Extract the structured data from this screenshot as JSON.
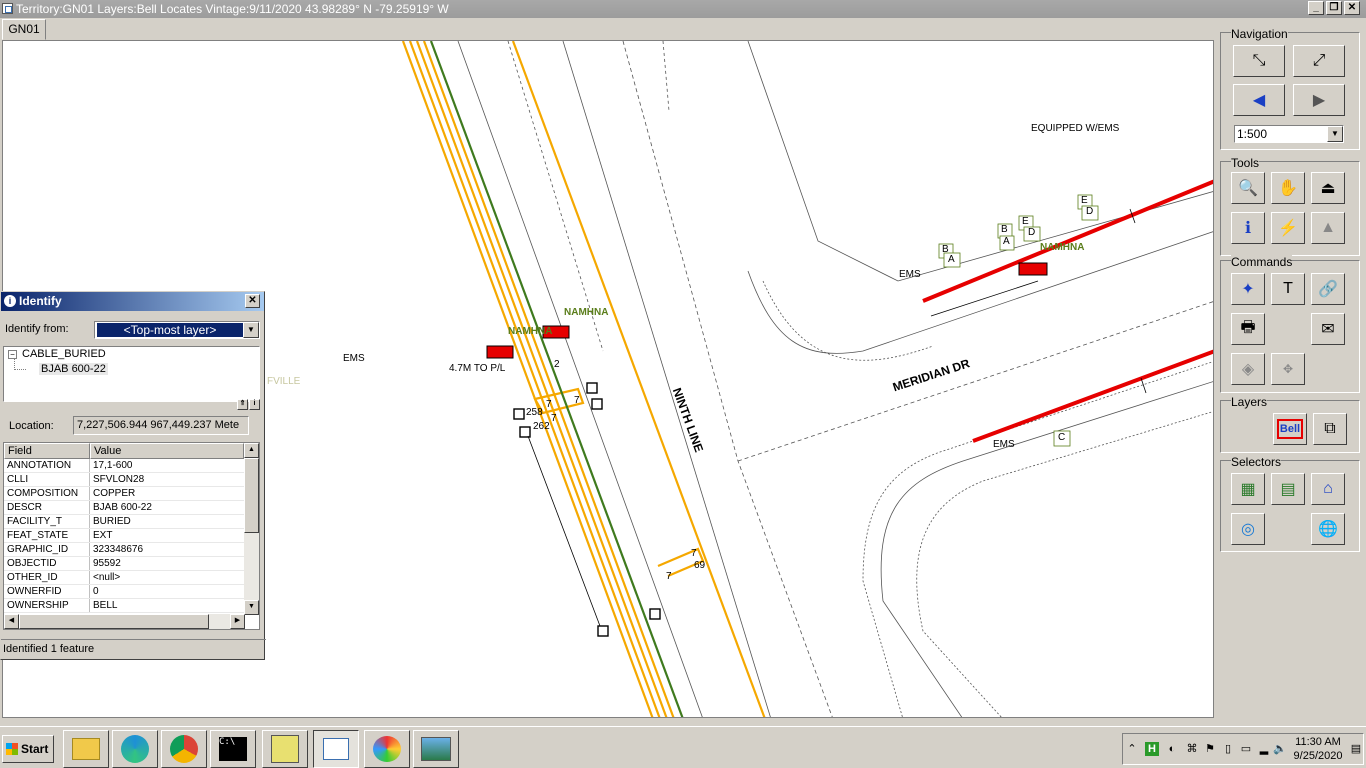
{
  "window": {
    "title": "Territory:GN01 Layers:Bell Locates Vintage:9/11/2020   43.98289° N   -79.25919° W",
    "controls": [
      "_",
      "❐",
      "✕"
    ]
  },
  "tabs": [
    {
      "label": "GN01"
    }
  ],
  "map": {
    "labels": {
      "equipped": "EQUIPPED W/EMS",
      "namhna1": "NAMHNA",
      "namhna2": "NAMHNA",
      "namhna3": "NAMHNA",
      "ems1": "EMS",
      "ems2": "EMS",
      "ems3": "EMS",
      "tolpl": "4.7M TO P/L",
      "fville": "FVILLE",
      "ninth": "NINTH LINE",
      "meridian": "MERIDIAN DR",
      "n2": "2",
      "n7a": "7",
      "n7b": "7",
      "n7c": "7",
      "n258": "258",
      "n262": "262",
      "n7d": "7",
      "n69": "69",
      "n7e": "7",
      "bA1": "B",
      "bA2": "A",
      "bA3": "B",
      "bA4": "A",
      "bE1": "E",
      "bD1": "D",
      "bE2": "E",
      "bD2": "D",
      "bC": "C"
    }
  },
  "navigation": {
    "title": "Navigation",
    "scale": "1:500",
    "buttons": [
      "zoom-in-extent",
      "zoom-full-extent",
      "back",
      "forward"
    ]
  },
  "tools": {
    "title": "Tools"
  },
  "commands": {
    "title": "Commands"
  },
  "layers": {
    "title": "Layers",
    "bell_label": "Bell"
  },
  "selectors": {
    "title": "Selectors"
  },
  "identify": {
    "title": "Identify",
    "from_label": "Identify from:",
    "from_value": "<Top-most layer>",
    "tree_root": "CABLE_BURIED",
    "tree_child": "BJAB 600-22",
    "location_label": "Location:",
    "location_value": "7,227,506.944  967,449.237 Mete",
    "col_field": "Field",
    "col_value": "Value",
    "rows": [
      {
        "field": "ANNOTATION",
        "value": "17,1-600"
      },
      {
        "field": "CLLI",
        "value": "SFVLON28"
      },
      {
        "field": "COMPOSITION",
        "value": "COPPER"
      },
      {
        "field": "DESCR",
        "value": "BJAB 600-22"
      },
      {
        "field": "FACILITY_T",
        "value": "BURIED"
      },
      {
        "field": "FEAT_STATE",
        "value": "EXT"
      },
      {
        "field": "GRAPHIC_ID",
        "value": "323348676"
      },
      {
        "field": "OBJECTID",
        "value": "95592"
      },
      {
        "field": "OTHER_ID",
        "value": "<null>"
      },
      {
        "field": "OWNERFID",
        "value": "0"
      },
      {
        "field": "OWNERSHIP",
        "value": "BELL"
      }
    ],
    "status": "Identified 1 feature"
  },
  "taskbar": {
    "start": "Start",
    "time": "11:30 AM",
    "date": "9/25/2020"
  },
  "colors": {
    "cable_orange": "#f5a800",
    "cable_green": "#3f7a1e",
    "cable_red": "#e60000",
    "label_green": "#5a7d1a"
  }
}
